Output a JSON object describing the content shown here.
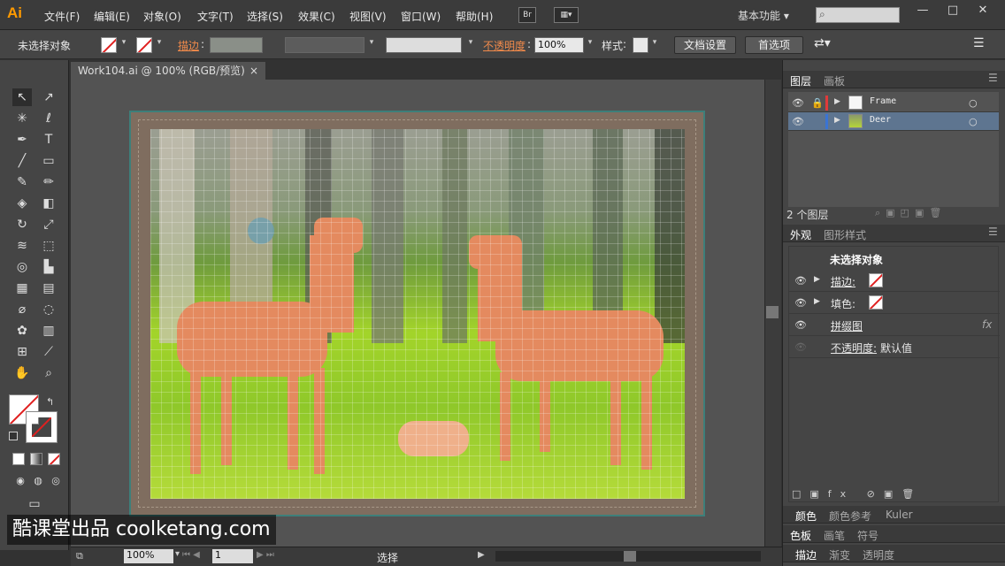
{
  "app": {
    "logo": "Ai",
    "workspace": "基本功能 ▾"
  },
  "menu": [
    "文件(F)",
    "编辑(E)",
    "对象(O)",
    "文字(T)",
    "选择(S)",
    "效果(C)",
    "视图(V)",
    "窗口(W)",
    "帮助(H)"
  ],
  "menubar_icons": {
    "bridge": "Br"
  },
  "window_controls": {
    "minimize": "—",
    "maximize": "□",
    "close": "✕"
  },
  "control": {
    "selection_status": "未选择对象",
    "stroke_label": "描边",
    "opacity_label": "不透明度",
    "opacity_value": "100%",
    "style_label": "样式",
    "doc_setup": "文档设置",
    "preferences": "首选项"
  },
  "document": {
    "tab_title": "Work104.ai @ 100% (RGB/预览)",
    "tab_close": "×"
  },
  "status": {
    "zoom": "100%",
    "page": "1",
    "tool": "选择"
  },
  "layers_panel": {
    "tabs": [
      "图层",
      "画板"
    ],
    "layers": [
      {
        "name": "Frame",
        "color": "#e03a3a",
        "locked": true
      },
      {
        "name": "Deer",
        "color": "#3a74d4",
        "locked": false
      }
    ],
    "count": "2 个图层"
  },
  "appearance_panel": {
    "tabs": [
      "外观",
      "图形样式"
    ],
    "header": "未选择对象",
    "rows": [
      {
        "label": "描边:",
        "link": true
      },
      {
        "label": "填色:",
        "link": false
      },
      {
        "label": "拼缀图",
        "link": true
      },
      {
        "label": "不透明度:",
        "link": true,
        "value": "默认值"
      }
    ],
    "fx": "fx"
  },
  "collapsed_panels": [
    [
      "颜色",
      "颜色参考",
      "Kuler"
    ],
    [
      "色板",
      "画笔",
      "符号"
    ],
    [
      "描边",
      "渐变",
      "透明度"
    ]
  ],
  "watermark": "酷课堂出品 coolketang.com",
  "colors": {
    "accent_link": "#f08a4b",
    "frame_border": "#3d7f7a",
    "selected_layer": "#5e7590"
  }
}
